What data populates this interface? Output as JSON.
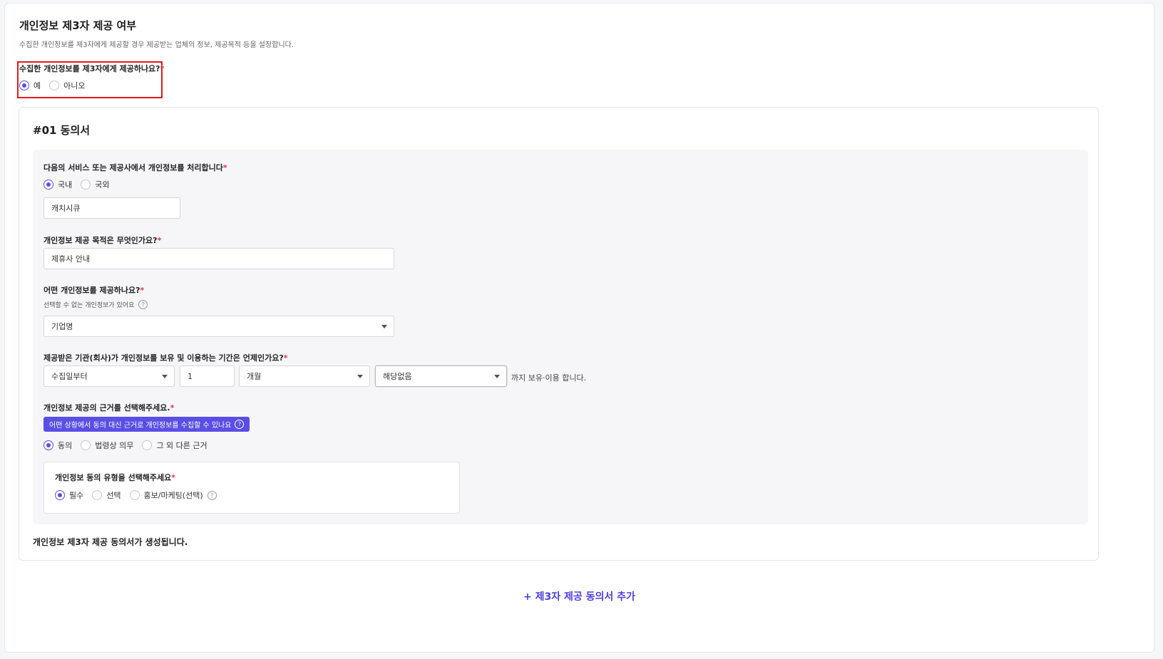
{
  "header": {
    "title": "개인정보 제3자 제공 여부",
    "description": "수집한 개인정보를 제3자에게 제공할 경우 제공받는 업체의 정보, 제공목적 등을 설정합니다."
  },
  "provide_question": {
    "label": "수집한 개인정보를 제3자에게 제공하나요?",
    "required_mark": "*",
    "options": [
      "예",
      "아니오"
    ],
    "selected": "예"
  },
  "consent": {
    "title": "#01 동의서",
    "processor": {
      "label": "다음의 서비스 또는 제공사에서 개인정보를 처리합니다",
      "options": [
        "국내",
        "국외"
      ],
      "selected": "국내",
      "value": "캐치시큐"
    },
    "purpose": {
      "label": "개인정보 제공 목적은 무엇인가요?",
      "value": "제휴사 안내"
    },
    "items": {
      "label": "어떤 개인정보를 제공하나요?",
      "hint": "선택할 수 없는 개인정보가 있어요",
      "selected": "기업명"
    },
    "retention": {
      "label": "제공받은 기관(회사)가 개인정보를 보유 및 이용하는 기간은 언제인가요?",
      "start": "수집일부터",
      "amount": "1",
      "unit": "개월",
      "exception": "해당없음",
      "suffix": "까지 보유·이용 합니다."
    },
    "basis": {
      "label": "개인정보 제공의 근거를 선택해주세요.",
      "help_button": "어떤 상황에서 동의 대신 근거로 개인정보를 수집할 수 있나요",
      "options": [
        "동의",
        "법령상 의무",
        "그 외 다른 근거"
      ],
      "selected": "동의"
    },
    "consent_type": {
      "label": "개인정보 동의 유형을 선택해주세요",
      "options": [
        "필수",
        "선택",
        "홍보/마케팅(선택)"
      ],
      "selected": "필수"
    },
    "footer_note": "개인정보 제3자 제공 동의서가 생성됩니다."
  },
  "add_button": "+ 제3자 제공 동의서 추가",
  "icons": {
    "help": "question-circle-icon",
    "dropdown": "chevron-down-icon"
  },
  "colors": {
    "accent": "#5b4ee6",
    "required": "#e0343c",
    "highlight_box": "#e01b1b"
  }
}
